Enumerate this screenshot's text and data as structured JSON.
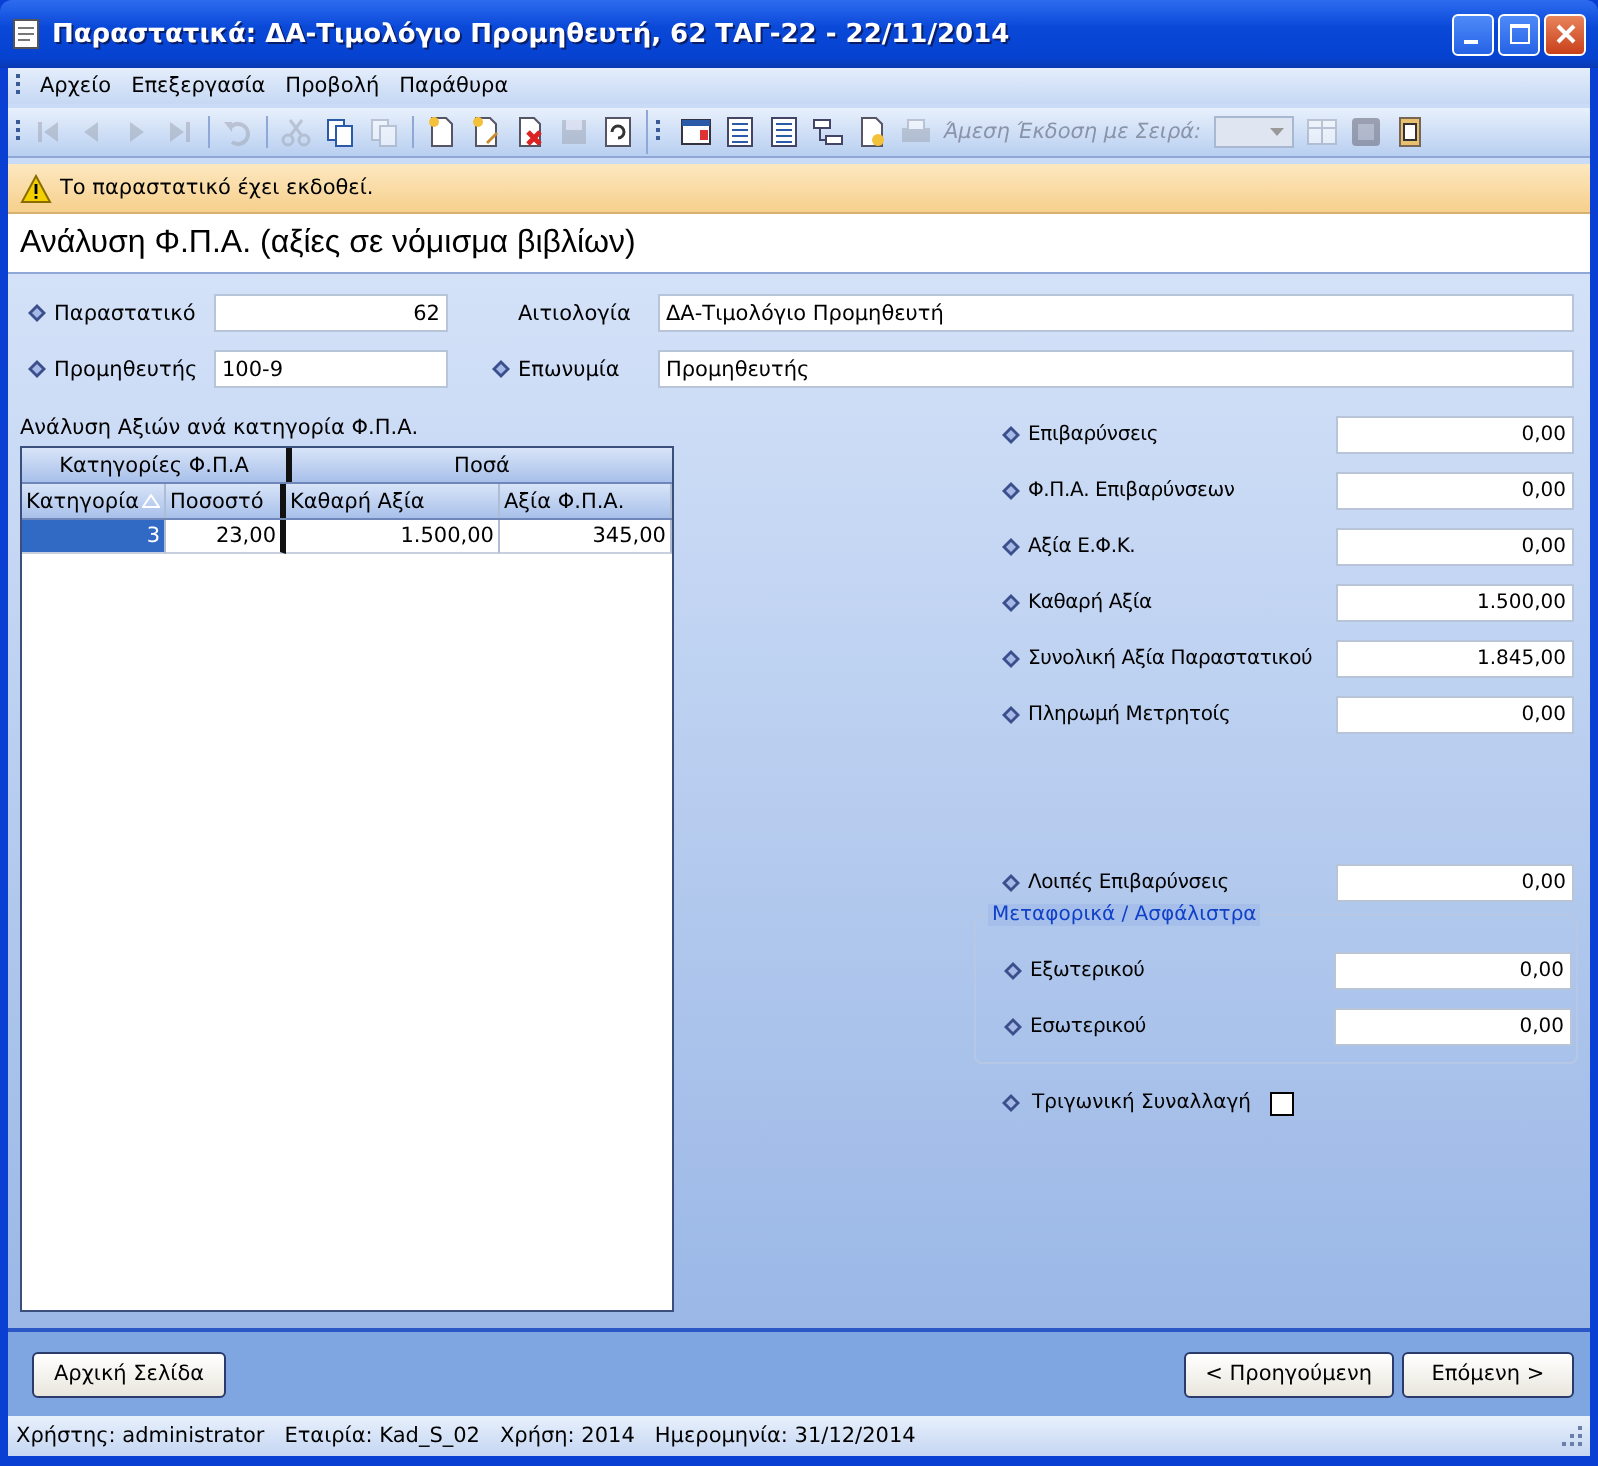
{
  "window": {
    "title": "Παραστατικά: ΔΑ-Τιμολόγιο Προμηθευτή, 62 ΤΑΓ-22 - 22/11/2014"
  },
  "menu": [
    "Αρχείο",
    "Επεξεργασία",
    "Προβολή",
    "Παράθυρα"
  ],
  "toolbar": [
    {
      "kind": "first",
      "disabled": true
    },
    {
      "kind": "prev",
      "disabled": true
    },
    {
      "kind": "next",
      "disabled": true
    },
    {
      "kind": "last",
      "disabled": true
    },
    {
      "kind": "sep"
    },
    {
      "kind": "undo",
      "disabled": true
    },
    {
      "kind": "sep"
    },
    {
      "kind": "cut",
      "disabled": true
    },
    {
      "kind": "copy",
      "disabled": false
    },
    {
      "kind": "paste",
      "disabled": true
    },
    {
      "kind": "sep"
    },
    {
      "kind": "new",
      "disabled": false
    },
    {
      "kind": "edit",
      "disabled": false
    },
    {
      "kind": "delete",
      "disabled": false
    },
    {
      "kind": "save",
      "disabled": true
    },
    {
      "kind": "refresh",
      "disabled": false
    },
    {
      "kind": "group"
    },
    {
      "kind": "form",
      "disabled": false
    },
    {
      "kind": "list",
      "disabled": false
    },
    {
      "kind": "list",
      "disabled": false
    },
    {
      "kind": "tree",
      "disabled": false
    },
    {
      "kind": "report",
      "disabled": false
    },
    {
      "kind": "print",
      "disabled": true
    },
    {
      "kind": "label",
      "text": "Άμεση Έκδοση με Σειρά:",
      "disabled": true
    },
    {
      "kind": "combo",
      "disabled": true
    },
    {
      "kind": "grid",
      "disabled": true
    },
    {
      "kind": "stop",
      "disabled": true
    },
    {
      "kind": "clip",
      "disabled": false
    }
  ],
  "warning": "Το παραστατικό έχει εκδοθεί.",
  "heading": "Ανάλυση Φ.Π.Α. (αξίες σε νόμισμα βιβλίων)",
  "header_fields": [
    {
      "label": "Παραστατικό",
      "value": "62",
      "kind": "number",
      "bullet": true
    },
    {
      "label": "Αιτιολογία",
      "value": "ΔΑ-Τιμολόγιο Προμηθευτή",
      "kind": "text",
      "bullet": false
    },
    {
      "label": "Προμηθευτής",
      "value": "100-9",
      "kind": "text",
      "bullet": true
    },
    {
      "label": "Επωνυμία",
      "value": "Προμηθευτής",
      "kind": "text",
      "bullet": true
    }
  ],
  "grid": {
    "caption": "Ανάλυση Αξιών ανά κατηγορία Φ.Π.Α.",
    "groups": [
      "Κατηγορίες Φ.Π.Α",
      "Ποσά"
    ],
    "columns": [
      {
        "label": "Κατηγορία",
        "sorted": true
      },
      {
        "label": "Ποσοστό",
        "sorted": false
      },
      {
        "label": "Καθαρή Αξία",
        "sorted": false
      },
      {
        "label": "Αξία Φ.Π.Α.",
        "sorted": false
      }
    ],
    "rows": [
      {
        "cells": [
          {
            "text": "3",
            "selected": true
          },
          {
            "text": "23,00",
            "selected": false
          },
          {
            "text": "1.500,00",
            "selected": false
          },
          {
            "text": "345,00",
            "selected": false
          }
        ]
      }
    ]
  },
  "totals": [
    {
      "label": "Επιβαρύνσεις",
      "value": "0,00"
    },
    {
      "label": "Φ.Π.Α. Επιβαρύνσεων",
      "value": "0,00"
    },
    {
      "label": "Αξία Ε.Φ.Κ.",
      "value": "0,00"
    },
    {
      "label": "Καθαρή Αξία",
      "value": "1.500,00"
    },
    {
      "label": "Συνολική Αξία Παραστατικού",
      "value": "1.845,00"
    },
    {
      "label": "Πληρωμή Μετρητοίς",
      "value": "0,00"
    }
  ],
  "other_charges": {
    "label": "Λοιπές Επιβαρύνσεις",
    "value": "0,00"
  },
  "freight": {
    "title": "Μεταφορικά / Ασφάλιστρα",
    "fields": [
      {
        "label": "Εξωτερικού",
        "value": "0,00"
      },
      {
        "label": "Εσωτερικού",
        "value": "0,00"
      }
    ]
  },
  "triangular": {
    "label": "Τριγωνική Συναλλαγή",
    "checked": false
  },
  "buttons": {
    "home": "Αρχική Σελίδα",
    "prev": "< Προηγούμενη",
    "next": "Επόμενη >"
  },
  "status_bar": [
    "Χρήστης: administrator",
    "Εταιρία: Kad_S_02",
    "Χρήση: 2014",
    "Ημερομηνία: 31/12/2014"
  ]
}
